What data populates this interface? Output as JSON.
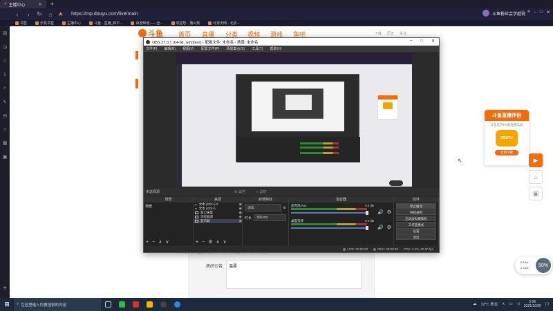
{
  "browser": {
    "tab_title": "主播中心",
    "url": "https://mp.douyu.com/live/main",
    "user_name": "斗鱼粉丝会学姐说",
    "bookmarks": [
      "书签",
      "手机书签",
      "主播中心",
      "斗鱼 - 直播_和平...",
      "百度知道——全...",
      "欢迎您 - 蒲公英",
      "北京天网 - 北京..."
    ]
  },
  "site": {
    "logo": "斗鱼",
    "nav": [
      "首页",
      "直播",
      "分类",
      "视频",
      "游戏",
      "鱼吧"
    ],
    "right_links": [
      "下载",
      "历史",
      "关注"
    ]
  },
  "obs": {
    "title": "OBS 27.0.1 (64-bit, windows) - 配置文件: 未命名 - 场景: 未命名",
    "menu": [
      "文件(F)",
      "编辑(E)",
      "视图(V)",
      "配置文件(P)",
      "场景集合(S)",
      "工具(T)",
      "帮助(H)"
    ],
    "bar_label": "未选择源",
    "bar_props": "属性",
    "bar_filters": "滤镜",
    "docks": {
      "scenes": "场景",
      "sources": "来源",
      "transitions": "转场特效",
      "mixer": "混音器",
      "controls": "控件"
    },
    "scene_items": [
      "场景"
    ],
    "sources": [
      {
        "name": "文本 (GDI+) 2",
        "icon": "text-icon"
      },
      {
        "name": "文本 (GDI+)",
        "icon": "text-icon"
      },
      {
        "name": "窗口采集",
        "icon": "window-icon"
      },
      {
        "name": "浏览器源",
        "icon": "globe-icon"
      },
      {
        "name": "显示器",
        "icon": "monitor-icon"
      }
    ],
    "transition": {
      "type": "淡出",
      "duration_label": "时长",
      "duration_value": "300 ms"
    },
    "mixer": [
      {
        "name": "麦克风/Aux",
        "db": "0.0 dB"
      },
      {
        "name": "桌面音频",
        "db": "0.0 dB"
      }
    ],
    "controls": [
      "停止推流",
      "开始录制",
      "启动虚拟摄像机",
      "工作室模式",
      "设置",
      "退出"
    ],
    "status": {
      "live": "LIVE: 00:00:00",
      "rec": "REC: 00:00:00",
      "cpu": "CPU: 1.2%, 60.00 fps"
    }
  },
  "promo": {
    "title": "斗鱼直播伴侣",
    "subtitle": "斗鱼官方PC端直播工具",
    "logo_text": "DOUYU",
    "button": "立即下载"
  },
  "form": {
    "red_hint": "请与您添加的直播内容保持一致，请勿选择与实际不符的分类",
    "notice_label": "房间公告:",
    "notice_value": "温柔"
  },
  "speed": {
    "value": "50%",
    "up": "0.1K/s",
    "down": "0.7K/s"
  },
  "taskbar": {
    "search_placeholder": "在这里输入你要搜索的内容",
    "weather": "12°C 多云",
    "time": "5:06",
    "date": "2021/10/30"
  }
}
